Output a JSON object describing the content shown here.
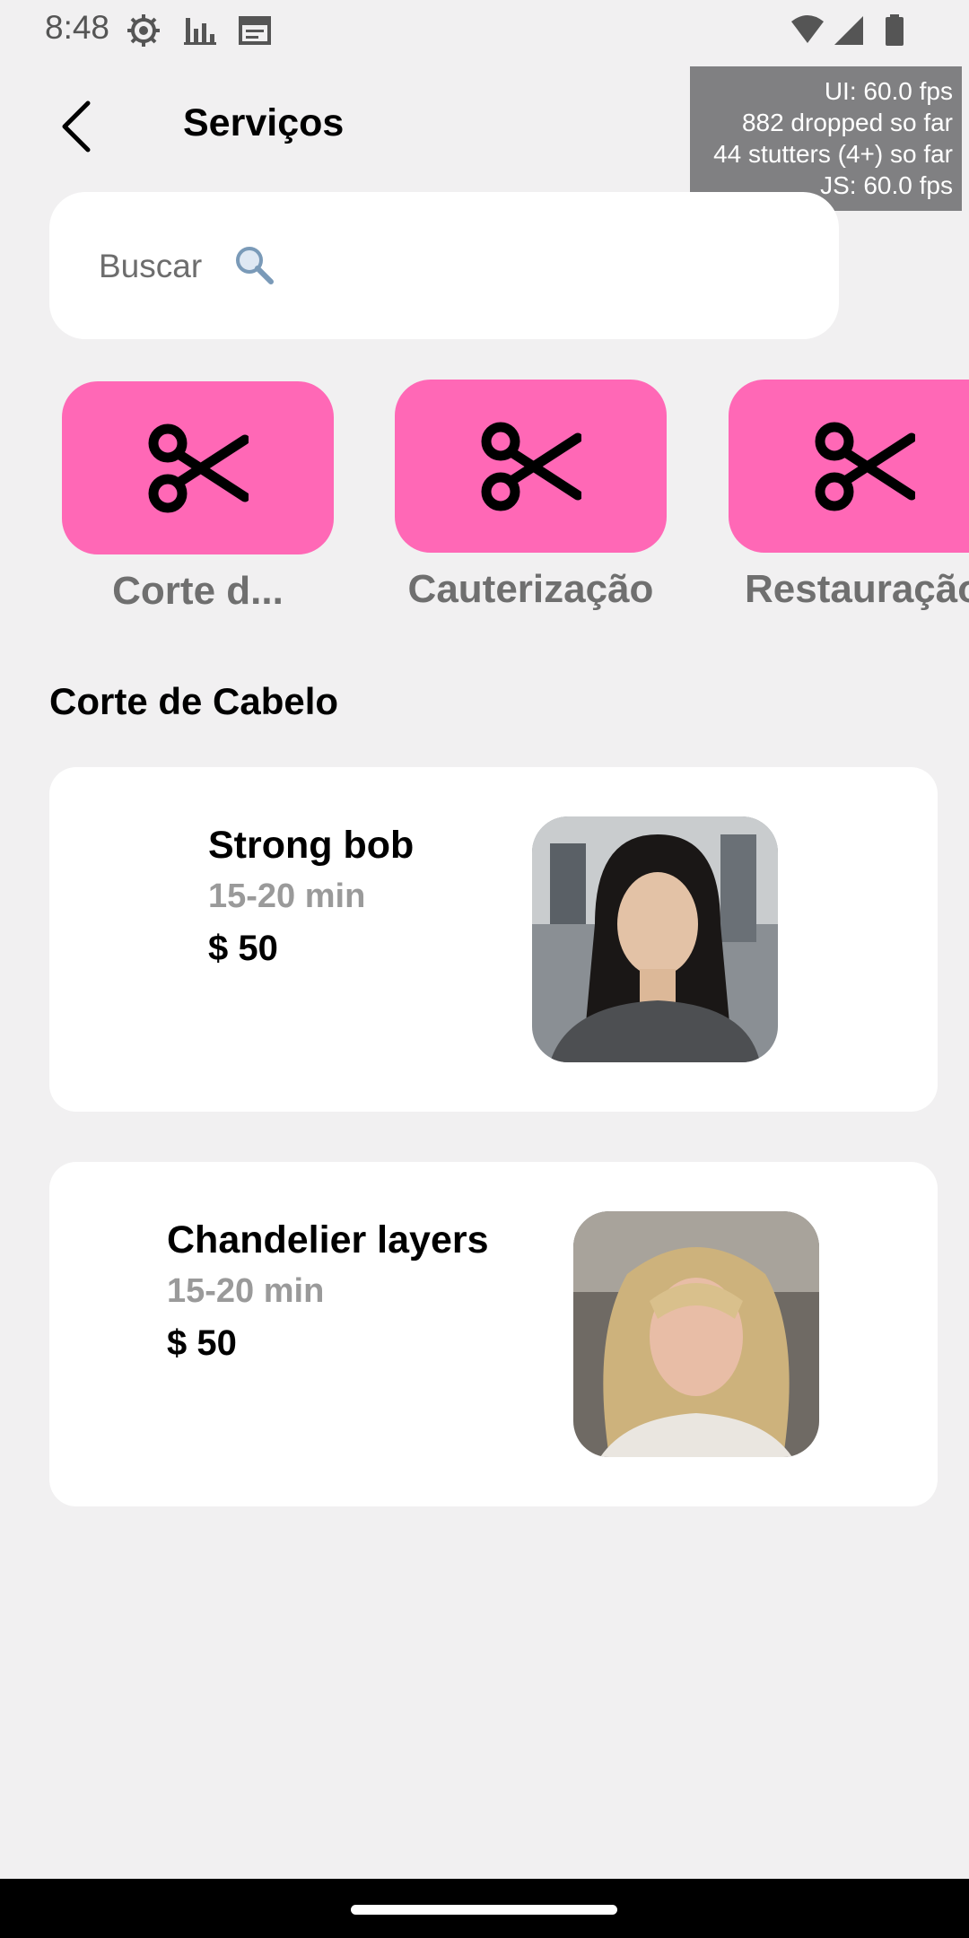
{
  "status_bar": {
    "time": "8:48",
    "icons": [
      "settings-icon",
      "bar-chart-icon",
      "calendar-icon",
      "wifi-icon",
      "signal-icon",
      "battery-icon"
    ]
  },
  "header": {
    "title": "Serviços",
    "back_icon": "chevron-left-icon"
  },
  "perf_overlay": {
    "line1": "UI: 60.0 fps",
    "line2": "882 dropped so far",
    "line3": "44 stutters (4+) so far",
    "line4": "JS: 60.0 fps"
  },
  "search": {
    "placeholder": "Buscar",
    "icon": "magnifier-icon"
  },
  "categories": [
    {
      "label": "Corte d...",
      "icon": "scissors-icon"
    },
    {
      "label": "Cauterização",
      "icon": "scissors-icon"
    },
    {
      "label": "Restauração",
      "icon": "scissors-icon"
    }
  ],
  "section": {
    "title": "Corte de Cabelo"
  },
  "services": [
    {
      "name": "Strong bob",
      "duration": "15-20 min",
      "price": "$ 50"
    },
    {
      "name": "Chandelier layers",
      "duration": "15-20 min",
      "price": "$ 50"
    }
  ],
  "colors": {
    "accent": "#ff68b6",
    "background": "#f1f0f1",
    "card": "#ffffff"
  }
}
